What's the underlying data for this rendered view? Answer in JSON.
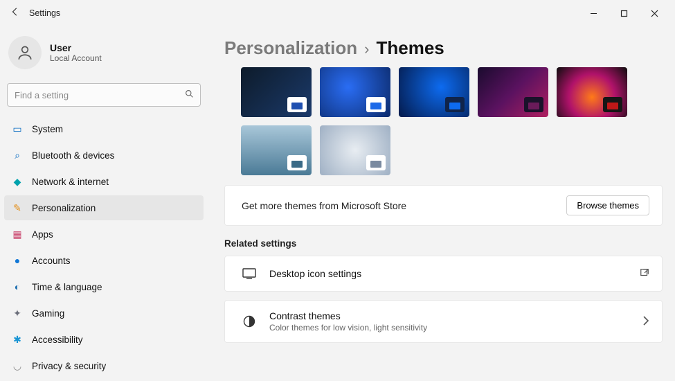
{
  "titlebar": {
    "title": "Settings"
  },
  "user": {
    "name": "User",
    "subtitle": "Local Account"
  },
  "search": {
    "placeholder": "Find a setting"
  },
  "nav": {
    "items": [
      {
        "label": "System",
        "icon_color": "#0067c0"
      },
      {
        "label": "Bluetooth & devices",
        "icon_color": "#0067c0"
      },
      {
        "label": "Network & internet",
        "icon_color": "#00a2ad"
      },
      {
        "label": "Personalization",
        "icon_color": "#e38f1a"
      },
      {
        "label": "Apps",
        "icon_color": "#c9416a"
      },
      {
        "label": "Accounts",
        "icon_color": "#1177d6"
      },
      {
        "label": "Time & language",
        "icon_color": "#1f6fb0"
      },
      {
        "label": "Gaming",
        "icon_color": "#6b6e7a"
      },
      {
        "label": "Accessibility",
        "icon_color": "#1995d4"
      },
      {
        "label": "Privacy & security",
        "icon_color": "#8c8c8c"
      }
    ],
    "active_index": 3
  },
  "breadcrumb": {
    "parent": "Personalization",
    "current": "Themes"
  },
  "themes": [
    {
      "bg": "linear-gradient(135deg,#0d1b2a,#1b3a6b)",
      "accent": "#1f4fb0",
      "swatch_bg": "#ffffff"
    },
    {
      "bg": "radial-gradient(circle at 40% 40%,#2a6df4,#0b2a6b)",
      "accent": "#1d6ae8",
      "swatch_bg": "#ffffff"
    },
    {
      "bg": "radial-gradient(circle at 60% 40%,#0d6bf0,#041a4a)",
      "accent": "#0d6bf0",
      "swatch_bg": "#10244a"
    },
    {
      "bg": "linear-gradient(135deg,#1a0b2e,#5b1260,#b02060)",
      "accent": "#6a1b5a",
      "swatch_bg": "#1a122a"
    },
    {
      "bg": "radial-gradient(circle at 50% 60%,#ff7a18,#b0126a,#0d0d0d)",
      "accent": "#c01818",
      "swatch_bg": "#161616"
    },
    {
      "bg": "linear-gradient(180deg,#a9c7d9,#4a7a96)",
      "accent": "#3a6a86",
      "swatch_bg": "#ffffff"
    },
    {
      "bg": "radial-gradient(circle at 50% 50%,#e8edf2,#9fb0c4)",
      "accent": "#7a8aa0",
      "swatch_bg": "#ffffff"
    }
  ],
  "store": {
    "text": "Get more themes from Microsoft Store",
    "button": "Browse themes"
  },
  "related": {
    "heading": "Related settings",
    "items": [
      {
        "title": "Desktop icon settings",
        "subtitle": "",
        "trail": "open"
      },
      {
        "title": "Contrast themes",
        "subtitle": "Color themes for low vision, light sensitivity",
        "trail": "chevron"
      }
    ]
  }
}
